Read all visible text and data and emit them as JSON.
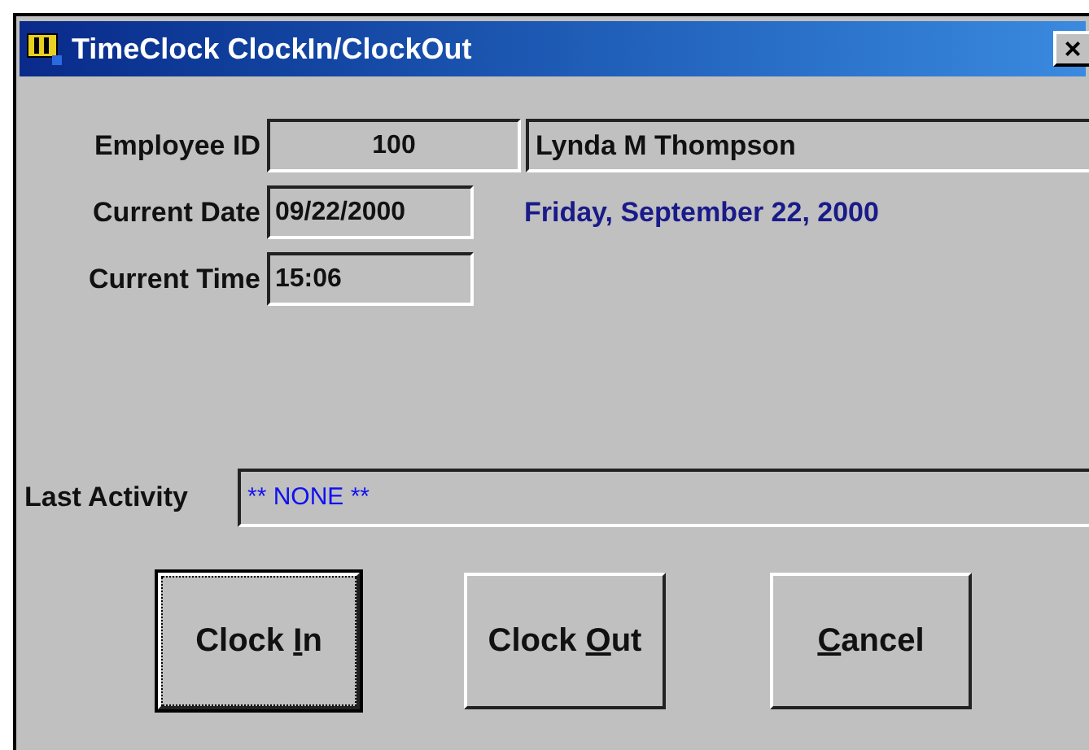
{
  "window": {
    "title": "TimeClock ClockIn/ClockOut",
    "close": "×"
  },
  "fields": [
    {
      "label": "Employee ID",
      "value": "100",
      "extra": "Lynda M Thompson"
    },
    {
      "label": "Current Date",
      "value": "09/22/2000",
      "note": "Friday, September 22, 2000"
    },
    {
      "label": "Current Time",
      "value": "15:06"
    }
  ],
  "last_activity": {
    "label": "Last Activity",
    "value": "** NONE **"
  },
  "buttons": [
    {
      "before": "Clock ",
      "key": "I",
      "after": "n",
      "focused": true
    },
    {
      "before": "Clock ",
      "key": "O",
      "after": "ut",
      "focused": false
    },
    {
      "key": "C",
      "after": "ancel",
      "focused": false
    }
  ]
}
